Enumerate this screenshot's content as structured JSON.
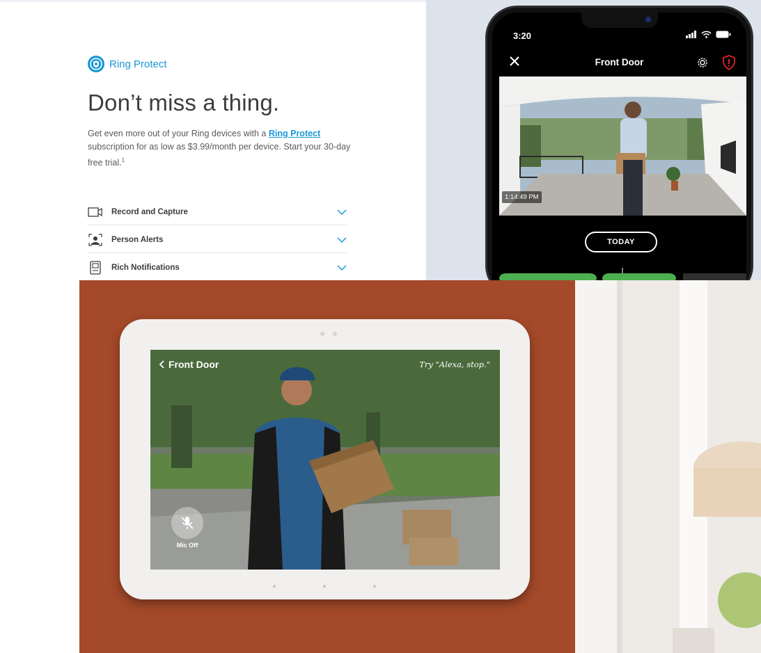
{
  "promo": {
    "brand": "Ring Protect",
    "headline": "Don’t miss a thing.",
    "desc_before": "Get even more out of your Ring devices with a ",
    "desc_link": "Ring Protect",
    "desc_after": " subscription for as low as $3.99/month per device. Start your 30-day free trial.",
    "desc_sup": "1",
    "features": [
      {
        "label": "Record and Capture",
        "icon": "camera-record-icon"
      },
      {
        "label": "Person Alerts",
        "icon": "person-alert-icon"
      },
      {
        "label": "Rich Notifications",
        "icon": "rich-notification-icon"
      }
    ],
    "accent_color": "#1998d5"
  },
  "phone": {
    "time": "3:20",
    "title": "Front Door",
    "timestamp": "1:14:49 PM",
    "today_label": "TODAY"
  },
  "echo": {
    "back_label": "Front Door",
    "hint": "Try \"Alexa, stop.\"",
    "mic_label": "Mic Off"
  }
}
